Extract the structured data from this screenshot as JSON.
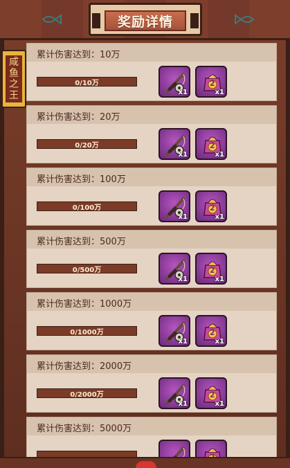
{
  "header": {
    "title": "奖励详情"
  },
  "side_tab": {
    "label": "咸鱼之王"
  },
  "rewards": [
    {
      "label": "累计伤害达到：10万",
      "progress_text": "0/10万",
      "progress": 0,
      "item1_qty": "x1",
      "item2_qty": "x1"
    },
    {
      "label": "累计伤害达到：20万",
      "progress_text": "0/20万",
      "progress": 0,
      "item1_qty": "x1",
      "item2_qty": "x1"
    },
    {
      "label": "累计伤害达到：100万",
      "progress_text": "0/100万",
      "progress": 0,
      "item1_qty": "x1",
      "item2_qty": "x1"
    },
    {
      "label": "累计伤害达到：500万",
      "progress_text": "0/500万",
      "progress": 0,
      "item1_qty": "x1",
      "item2_qty": "x1"
    },
    {
      "label": "累计伤害达到：1000万",
      "progress_text": "0/1000万",
      "progress": 0,
      "item1_qty": "x1",
      "item2_qty": "x1"
    },
    {
      "label": "累计伤害达到：2000万",
      "progress_text": "0/2000万",
      "progress": 0,
      "item1_qty": "x1",
      "item2_qty": "x1"
    },
    {
      "label": "累计伤害达到：5000万",
      "progress_text": "",
      "progress": 0,
      "item1_qty": "",
      "item2_qty": ""
    }
  ],
  "items": {
    "item1_icon": "fishing-rod-icon",
    "item2_icon": "gift-bag-icon",
    "bag_number": "2"
  },
  "colors": {
    "panel": "#7a3e2a",
    "card": "#e5d4c3",
    "progress_bar": "#7b3b27",
    "item_slot": "#9a3fa8",
    "title_plate": "#c96d4e"
  }
}
